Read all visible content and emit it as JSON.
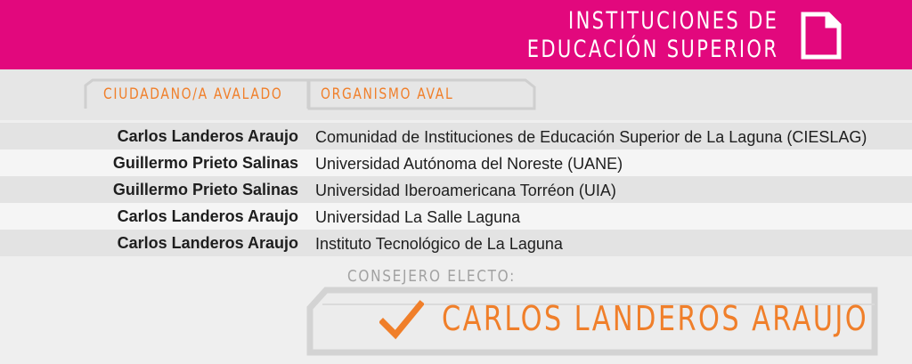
{
  "header": {
    "title_line1": "INSTITUCIONES DE",
    "title_line2": "EDUCACIÓN SUPERIOR",
    "icon": "document-icon"
  },
  "columns": {
    "person": "CIUDADANO/A AVALADO",
    "org": "ORGANISMO AVAL"
  },
  "rows": [
    {
      "person": "Carlos Landeros Araujo",
      "org": "Comunidad de Instituciones de Educación Superior de La Laguna (CIESLAG)"
    },
    {
      "person": "Guillermo Prieto Salinas",
      "org": "Universidad Autónoma del Noreste (UANE)"
    },
    {
      "person": "Guillermo Prieto Salinas",
      "org": "Universidad Iberoamericana Torréon (UIA)"
    },
    {
      "person": "Carlos Landeros Araujo",
      "org": "Universidad La Salle Laguna"
    },
    {
      "person": "Carlos Landeros Araujo",
      "org": "Instituto Tecnológico de La Laguna"
    }
  ],
  "elected": {
    "label": "CONSEJERO ELECTO:",
    "name": "CARLOS LANDEROS ARAUJO",
    "icon": "checkmark-icon"
  },
  "colors": {
    "brand": "#e2087d",
    "accent": "#f07f2a",
    "muted": "#a2a2a2"
  }
}
